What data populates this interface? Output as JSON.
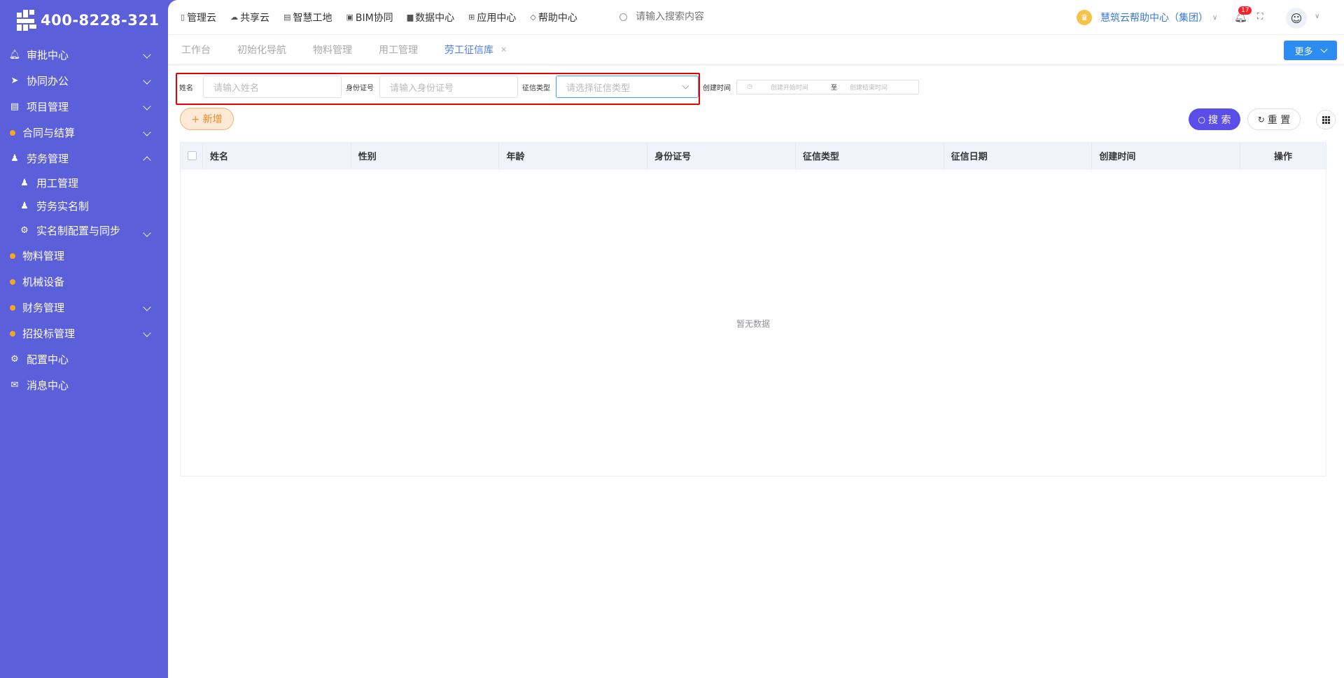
{
  "brand": {
    "phone": "400-8228-321"
  },
  "sidebar": {
    "items": [
      {
        "label": "审批中心",
        "icon": "bell-icon",
        "type": "icon",
        "expand": "down"
      },
      {
        "label": "协同办公",
        "icon": "send-icon",
        "type": "icon",
        "expand": "down"
      },
      {
        "label": "项目管理",
        "icon": "book-icon",
        "type": "icon",
        "expand": "down"
      },
      {
        "label": "合同与结算",
        "icon": "diamond-icon",
        "type": "dot",
        "expand": "down"
      },
      {
        "label": "劳务管理",
        "icon": "user-icon",
        "type": "icon",
        "expand": "up"
      },
      {
        "label": "用工管理",
        "icon": "user-icon",
        "type": "sub"
      },
      {
        "label": "劳务实名制",
        "icon": "user-icon",
        "type": "sub"
      },
      {
        "label": "实名制配置与同步",
        "icon": "gear-icon",
        "type": "sub",
        "expand": "down"
      },
      {
        "label": "物料管理",
        "icon": "diamond-icon",
        "type": "dot"
      },
      {
        "label": "机械设备",
        "icon": "diamond-icon",
        "type": "dot"
      },
      {
        "label": "财务管理",
        "icon": "diamond-icon",
        "type": "dot",
        "expand": "down"
      },
      {
        "label": "招投标管理",
        "icon": "diamond-icon",
        "type": "dot",
        "expand": "down"
      },
      {
        "label": "配置中心",
        "icon": "gear-icon",
        "type": "icon"
      },
      {
        "label": "消息中心",
        "icon": "message-icon",
        "type": "icon"
      }
    ]
  },
  "topnav": [
    {
      "label": "管理云",
      "icon": "doc-icon"
    },
    {
      "label": "共享云",
      "icon": "cloud-icon"
    },
    {
      "label": "智慧工地",
      "icon": "book-icon"
    },
    {
      "label": "BIM协同",
      "icon": "cube-icon"
    },
    {
      "label": "数据中心",
      "icon": "bar-chart-icon"
    },
    {
      "label": "应用中心",
      "icon": "apps-icon"
    },
    {
      "label": "帮助中心",
      "icon": "help-icon"
    }
  ],
  "search": {
    "placeholder": "请输入搜索内容"
  },
  "org": {
    "name": "慧筑云帮助中心（集团）"
  },
  "notifications": {
    "count": "17"
  },
  "tabs": [
    {
      "label": "工作台",
      "active": false
    },
    {
      "label": "初始化导航",
      "active": false
    },
    {
      "label": "物料管理",
      "active": false
    },
    {
      "label": "用工管理",
      "active": false
    },
    {
      "label": "劳工征信库",
      "active": true,
      "close": "×"
    }
  ],
  "more_label": "更多",
  "filter": {
    "name_label": "姓名",
    "name_placeholder": "请输入姓名",
    "id_label": "身份证号",
    "id_placeholder": "请输入身份证号",
    "type_label": "征信类型",
    "type_placeholder": "请选择征信类型",
    "time_label": "创建时间",
    "start_placeholder": "创建开始时间",
    "range_sep": "至",
    "end_placeholder": "创建结束时间"
  },
  "actions": {
    "add": "+ 新增",
    "search": "搜 索",
    "reset": "重 置"
  },
  "table": {
    "columns": [
      "姓名",
      "性别",
      "年龄",
      "身份证号",
      "征信类型",
      "征信日期",
      "创建时间",
      "操作"
    ],
    "rows": [],
    "empty_text": "暂无数据"
  },
  "colors": {
    "sidebar": "#5b5fd9",
    "primary": "#5b4ee8",
    "accent": "#2d8cf0",
    "warning": "#f08a24"
  }
}
